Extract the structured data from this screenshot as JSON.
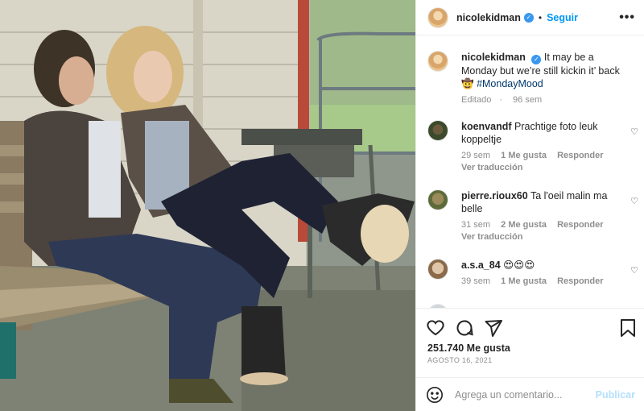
{
  "header": {
    "username": "nicolekidman",
    "separator": "•",
    "follow_label": "Seguir",
    "more_icon": "more-horizontal-icon",
    "verified_icon": "verified-badge-icon"
  },
  "caption": {
    "username": "nicolekidman",
    "text": "It may be a Monday but we’re still kickin it’ back 🤠",
    "hashtag": "#MondayMood",
    "edited": "Editado",
    "age": "96 sem"
  },
  "comments": [
    {
      "username": "koenvandf",
      "text": "Prachtige foto leuk koppeltje",
      "age": "29 sem",
      "likes": "1 Me gusta",
      "reply": "Responder",
      "translate": "Ver traducción"
    },
    {
      "username": "pierre.rioux60",
      "text": "Ta l'oeil malin ma belle",
      "age": "31 sem",
      "likes": "2 Me gusta",
      "reply": "Responder",
      "translate": "Ver traducción"
    },
    {
      "username": "a.s.a_84",
      "text": "😍😍😍",
      "age": "39 sem",
      "likes": "1 Me gusta",
      "reply": "Responder"
    }
  ],
  "actions": {
    "like_icon": "heart-icon",
    "comment_icon": "comment-icon",
    "share_icon": "share-icon",
    "save_icon": "bookmark-icon",
    "likes": "251.740 Me gusta",
    "date": "AGOSTO 16, 2021"
  },
  "composer": {
    "emoji_icon": "emoji-icon",
    "placeholder": "Agrega un comentario...",
    "post_label": "Publicar"
  },
  "colors": {
    "accent": "#0095f6",
    "muted": "#8e8e8e",
    "border": "#efefef",
    "post_disabled": "#b2dffc"
  }
}
